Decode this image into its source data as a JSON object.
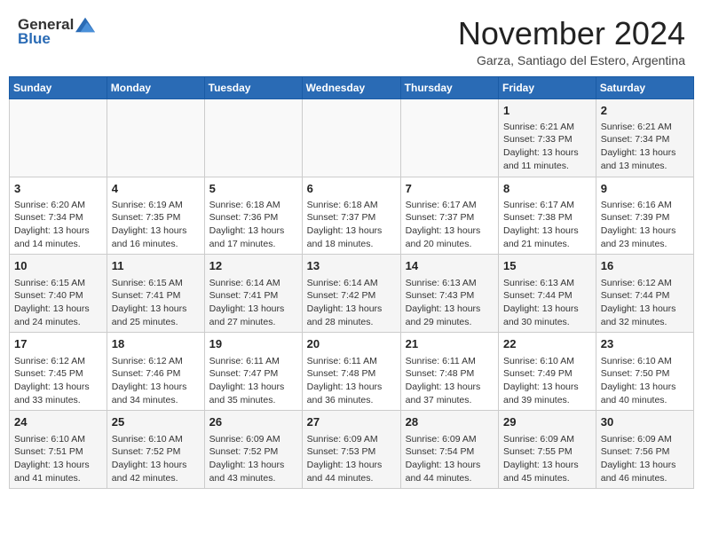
{
  "header": {
    "logo_general": "General",
    "logo_blue": "Blue",
    "month_title": "November 2024",
    "subtitle": "Garza, Santiago del Estero, Argentina"
  },
  "days_of_week": [
    "Sunday",
    "Monday",
    "Tuesday",
    "Wednesday",
    "Thursday",
    "Friday",
    "Saturday"
  ],
  "weeks": [
    [
      {
        "day": "",
        "info": ""
      },
      {
        "day": "",
        "info": ""
      },
      {
        "day": "",
        "info": ""
      },
      {
        "day": "",
        "info": ""
      },
      {
        "day": "",
        "info": ""
      },
      {
        "day": "1",
        "info": "Sunrise: 6:21 AM\nSunset: 7:33 PM\nDaylight: 13 hours and 11 minutes."
      },
      {
        "day": "2",
        "info": "Sunrise: 6:21 AM\nSunset: 7:34 PM\nDaylight: 13 hours and 13 minutes."
      }
    ],
    [
      {
        "day": "3",
        "info": "Sunrise: 6:20 AM\nSunset: 7:34 PM\nDaylight: 13 hours and 14 minutes."
      },
      {
        "day": "4",
        "info": "Sunrise: 6:19 AM\nSunset: 7:35 PM\nDaylight: 13 hours and 16 minutes."
      },
      {
        "day": "5",
        "info": "Sunrise: 6:18 AM\nSunset: 7:36 PM\nDaylight: 13 hours and 17 minutes."
      },
      {
        "day": "6",
        "info": "Sunrise: 6:18 AM\nSunset: 7:37 PM\nDaylight: 13 hours and 18 minutes."
      },
      {
        "day": "7",
        "info": "Sunrise: 6:17 AM\nSunset: 7:37 PM\nDaylight: 13 hours and 20 minutes."
      },
      {
        "day": "8",
        "info": "Sunrise: 6:17 AM\nSunset: 7:38 PM\nDaylight: 13 hours and 21 minutes."
      },
      {
        "day": "9",
        "info": "Sunrise: 6:16 AM\nSunset: 7:39 PM\nDaylight: 13 hours and 23 minutes."
      }
    ],
    [
      {
        "day": "10",
        "info": "Sunrise: 6:15 AM\nSunset: 7:40 PM\nDaylight: 13 hours and 24 minutes."
      },
      {
        "day": "11",
        "info": "Sunrise: 6:15 AM\nSunset: 7:41 PM\nDaylight: 13 hours and 25 minutes."
      },
      {
        "day": "12",
        "info": "Sunrise: 6:14 AM\nSunset: 7:41 PM\nDaylight: 13 hours and 27 minutes."
      },
      {
        "day": "13",
        "info": "Sunrise: 6:14 AM\nSunset: 7:42 PM\nDaylight: 13 hours and 28 minutes."
      },
      {
        "day": "14",
        "info": "Sunrise: 6:13 AM\nSunset: 7:43 PM\nDaylight: 13 hours and 29 minutes."
      },
      {
        "day": "15",
        "info": "Sunrise: 6:13 AM\nSunset: 7:44 PM\nDaylight: 13 hours and 30 minutes."
      },
      {
        "day": "16",
        "info": "Sunrise: 6:12 AM\nSunset: 7:44 PM\nDaylight: 13 hours and 32 minutes."
      }
    ],
    [
      {
        "day": "17",
        "info": "Sunrise: 6:12 AM\nSunset: 7:45 PM\nDaylight: 13 hours and 33 minutes."
      },
      {
        "day": "18",
        "info": "Sunrise: 6:12 AM\nSunset: 7:46 PM\nDaylight: 13 hours and 34 minutes."
      },
      {
        "day": "19",
        "info": "Sunrise: 6:11 AM\nSunset: 7:47 PM\nDaylight: 13 hours and 35 minutes."
      },
      {
        "day": "20",
        "info": "Sunrise: 6:11 AM\nSunset: 7:48 PM\nDaylight: 13 hours and 36 minutes."
      },
      {
        "day": "21",
        "info": "Sunrise: 6:11 AM\nSunset: 7:48 PM\nDaylight: 13 hours and 37 minutes."
      },
      {
        "day": "22",
        "info": "Sunrise: 6:10 AM\nSunset: 7:49 PM\nDaylight: 13 hours and 39 minutes."
      },
      {
        "day": "23",
        "info": "Sunrise: 6:10 AM\nSunset: 7:50 PM\nDaylight: 13 hours and 40 minutes."
      }
    ],
    [
      {
        "day": "24",
        "info": "Sunrise: 6:10 AM\nSunset: 7:51 PM\nDaylight: 13 hours and 41 minutes."
      },
      {
        "day": "25",
        "info": "Sunrise: 6:10 AM\nSunset: 7:52 PM\nDaylight: 13 hours and 42 minutes."
      },
      {
        "day": "26",
        "info": "Sunrise: 6:09 AM\nSunset: 7:52 PM\nDaylight: 13 hours and 43 minutes."
      },
      {
        "day": "27",
        "info": "Sunrise: 6:09 AM\nSunset: 7:53 PM\nDaylight: 13 hours and 44 minutes."
      },
      {
        "day": "28",
        "info": "Sunrise: 6:09 AM\nSunset: 7:54 PM\nDaylight: 13 hours and 44 minutes."
      },
      {
        "day": "29",
        "info": "Sunrise: 6:09 AM\nSunset: 7:55 PM\nDaylight: 13 hours and 45 minutes."
      },
      {
        "day": "30",
        "info": "Sunrise: 6:09 AM\nSunset: 7:56 PM\nDaylight: 13 hours and 46 minutes."
      }
    ]
  ]
}
